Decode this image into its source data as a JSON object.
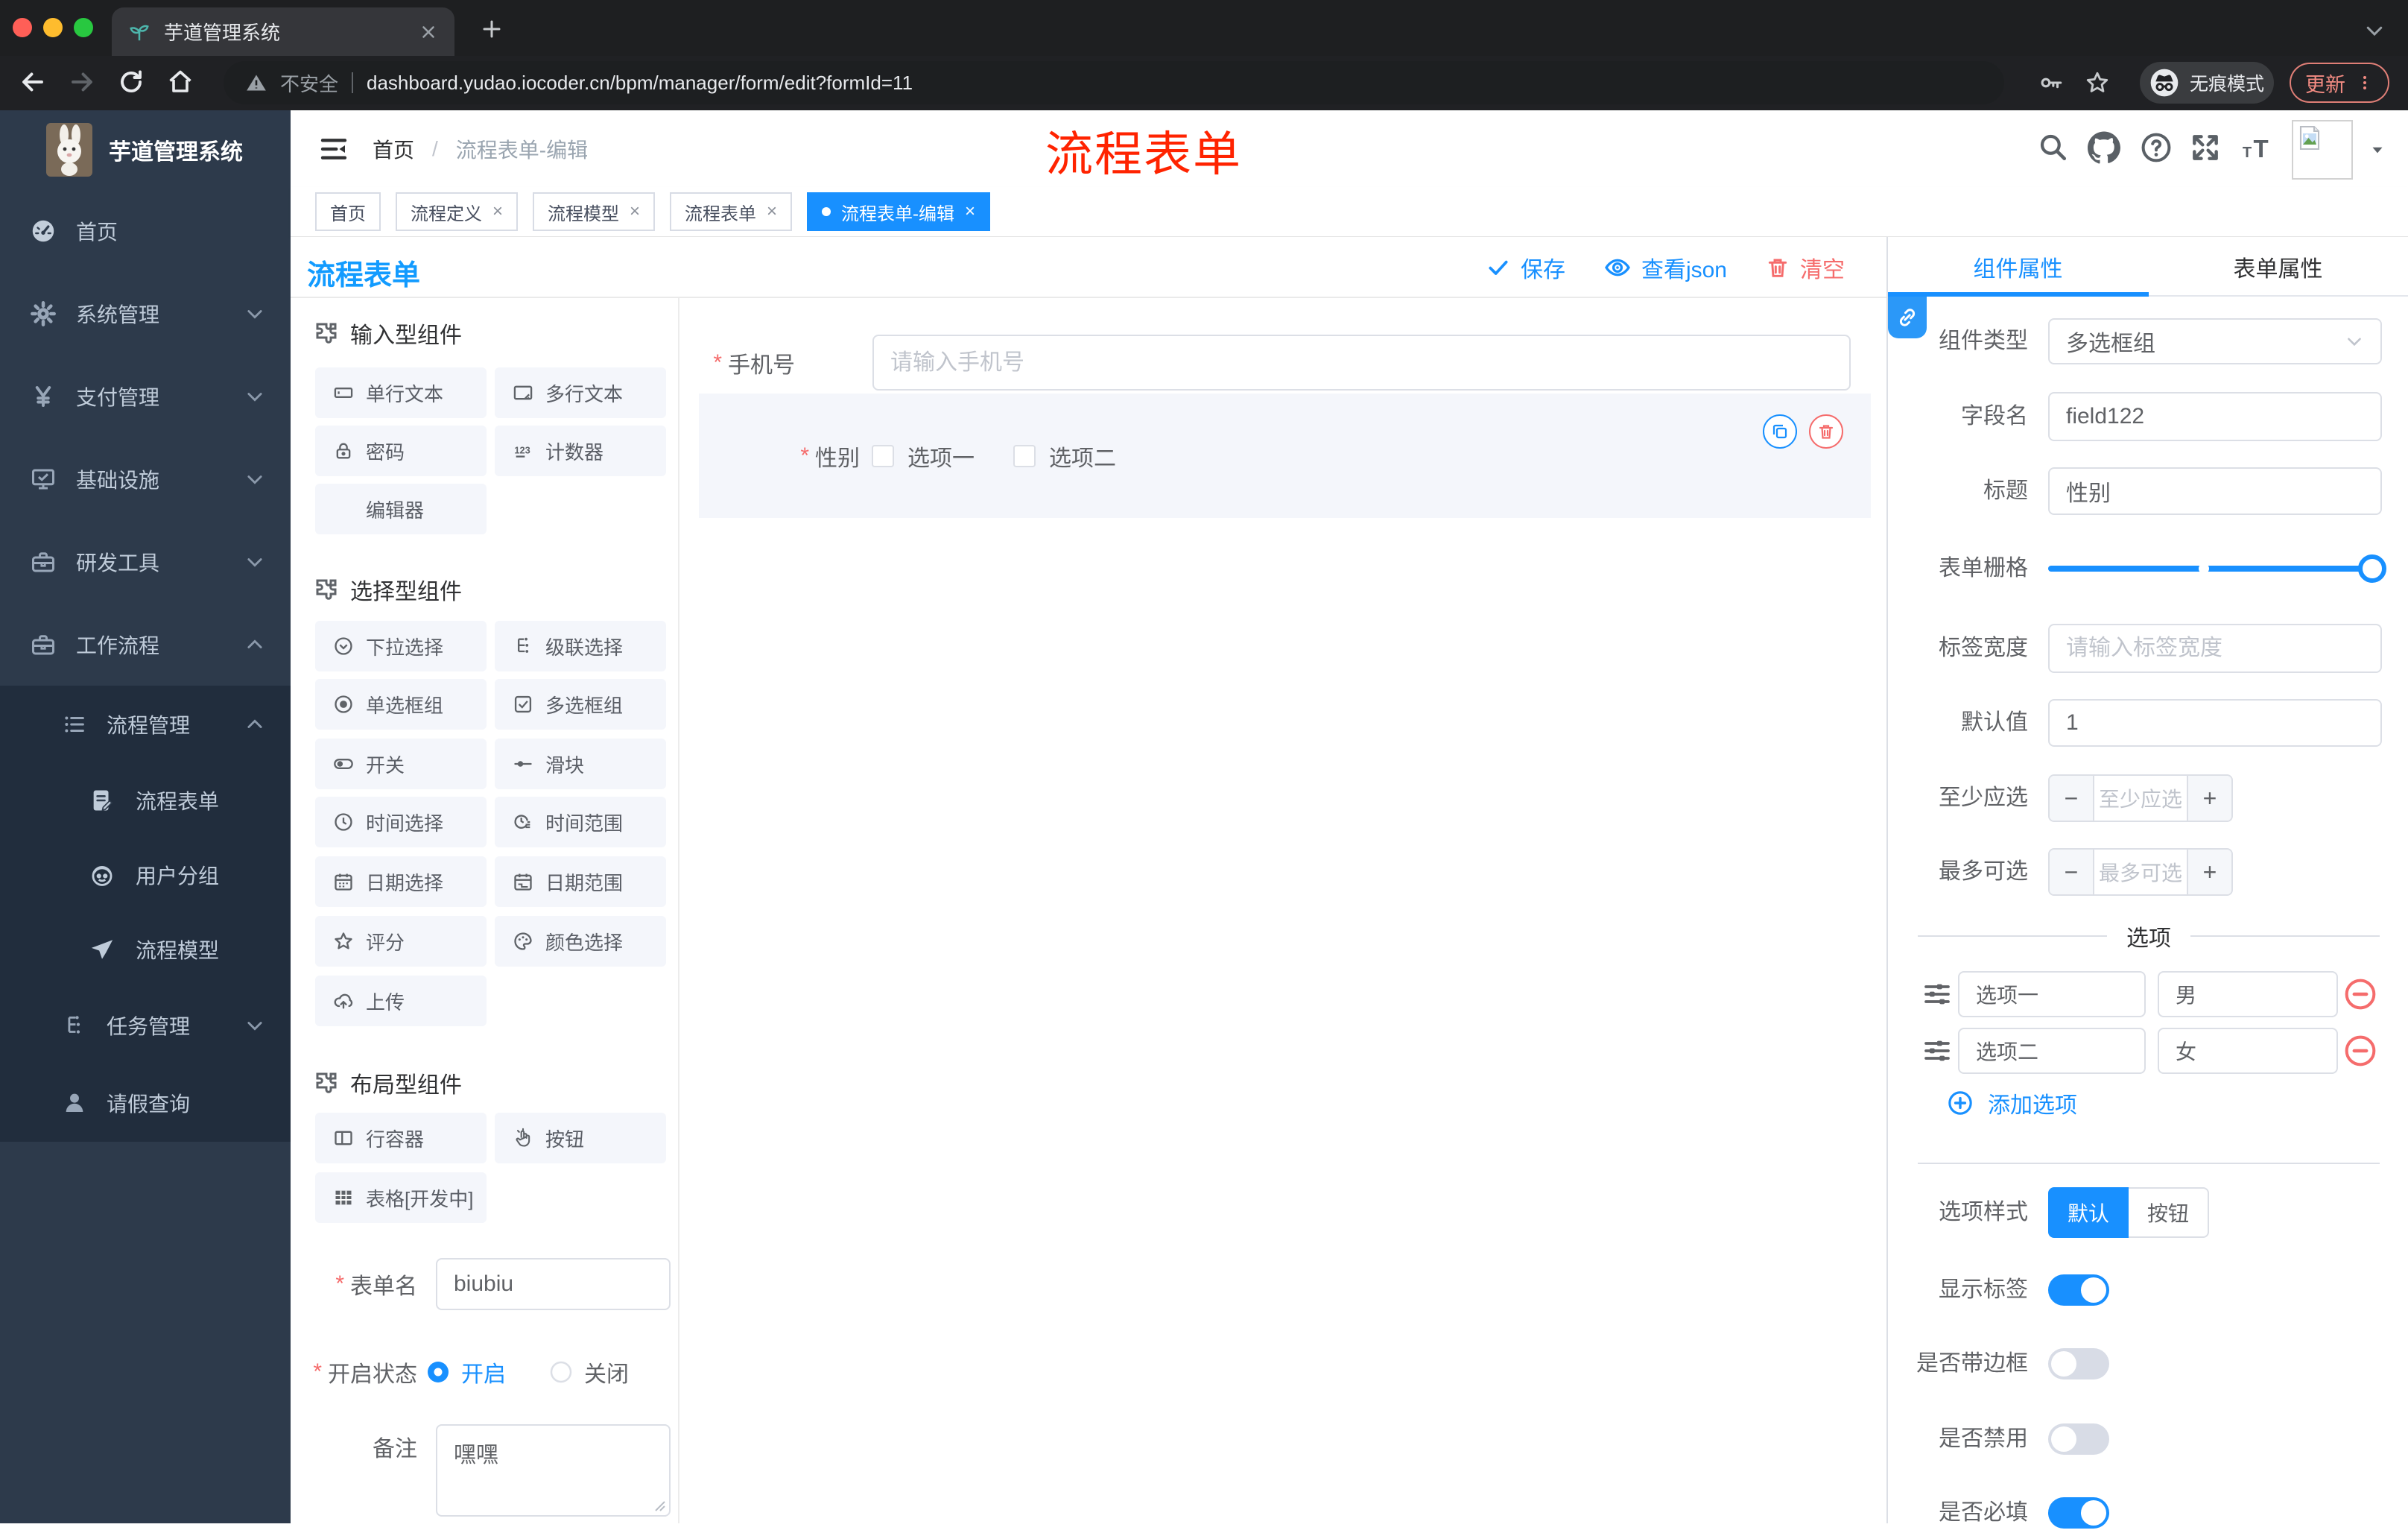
{
  "browser": {
    "tab": {
      "title": "芋道管理系统"
    },
    "address": {
      "security": "不安全",
      "url": "dashboard.yudao.iocoder.cn/bpm/manager/form/edit?formId=11"
    },
    "incognito": "无痕模式",
    "update": "更新"
  },
  "sidebar": {
    "title": "芋道管理系统",
    "items": [
      {
        "label": "首页"
      },
      {
        "label": "系统管理"
      },
      {
        "label": "支付管理"
      },
      {
        "label": "基础设施"
      },
      {
        "label": "研发工具"
      },
      {
        "label": "工作流程"
      },
      {
        "label": "流程管理"
      },
      {
        "label": "流程表单"
      },
      {
        "label": "用户分组"
      },
      {
        "label": "流程模型"
      },
      {
        "label": "任务管理"
      },
      {
        "label": "请假查询"
      }
    ]
  },
  "navbar": {
    "breadcrumb": [
      "首页",
      "流程表单-编辑"
    ],
    "annotation": "流程表单"
  },
  "tags": [
    {
      "label": "首页"
    },
    {
      "label": "流程定义"
    },
    {
      "label": "流程模型"
    },
    {
      "label": "流程表单"
    },
    {
      "label": "流程表单-编辑"
    }
  ],
  "toolbar": {
    "title": "流程表单",
    "save": "保存",
    "view_json": "查看json",
    "clear": "清空"
  },
  "palette": {
    "sections": [
      {
        "title": "输入型组件",
        "items": [
          {
            "label": "单行文本"
          },
          {
            "label": "多行文本"
          },
          {
            "label": "密码"
          },
          {
            "label": "计数器"
          },
          {
            "label": "编辑器"
          }
        ]
      },
      {
        "title": "选择型组件",
        "items": [
          {
            "label": "下拉选择"
          },
          {
            "label": "级联选择"
          },
          {
            "label": "单选框组"
          },
          {
            "label": "多选框组"
          },
          {
            "label": "开关"
          },
          {
            "label": "滑块"
          },
          {
            "label": "时间选择"
          },
          {
            "label": "时间范围"
          },
          {
            "label": "日期选择"
          },
          {
            "label": "日期范围"
          },
          {
            "label": "评分"
          },
          {
            "label": "颜色选择"
          },
          {
            "label": "上传"
          }
        ]
      },
      {
        "title": "布局型组件",
        "items": [
          {
            "label": "行容器"
          },
          {
            "label": "按钮"
          },
          {
            "label": "表格[开发中]"
          }
        ]
      }
    ]
  },
  "form_meta": {
    "name_label": "表单名",
    "name_value": "biubiu",
    "status_label": "开启状态",
    "status_on": "开启",
    "status_off": "关闭",
    "remark_label": "备注",
    "remark_value": "嘿嘿"
  },
  "canvas": {
    "phone": {
      "label": "手机号",
      "placeholder": "请输入手机号"
    },
    "gender": {
      "label": "性别",
      "options": [
        "选项一",
        "选项二"
      ]
    }
  },
  "props": {
    "tabs": [
      "组件属性",
      "表单属性"
    ],
    "component_type": {
      "label": "组件类型",
      "value": "多选框组"
    },
    "field_name": {
      "label": "字段名",
      "value": "field122"
    },
    "title": {
      "label": "标题",
      "value": "性别"
    },
    "grid": {
      "label": "表单栅格"
    },
    "label_width": {
      "label": "标签宽度",
      "placeholder": "请输入标签宽度"
    },
    "default_value": {
      "label": "默认值",
      "value": "1"
    },
    "min_select": {
      "label": "至少应选",
      "placeholder": "至少应选"
    },
    "max_select": {
      "label": "最多可选",
      "placeholder": "最多可选"
    },
    "options_title": "选项",
    "options": [
      {
        "label": "选项一",
        "value": "男"
      },
      {
        "label": "选项二",
        "value": "女"
      }
    ],
    "add_option": "添加选项",
    "option_style": {
      "label": "选项样式",
      "default": "默认",
      "button": "按钮",
      "active": "默认"
    },
    "show_label": {
      "label": "显示标签",
      "on": true
    },
    "border": {
      "label": "是否带边框",
      "on": false
    },
    "disabled": {
      "label": "是否禁用",
      "on": false
    },
    "required": {
      "label": "是否必填",
      "on": true
    }
  },
  "colors": {
    "accent": "#1890ff",
    "danger": "#f56c6c",
    "annotation": "#ff2300"
  }
}
